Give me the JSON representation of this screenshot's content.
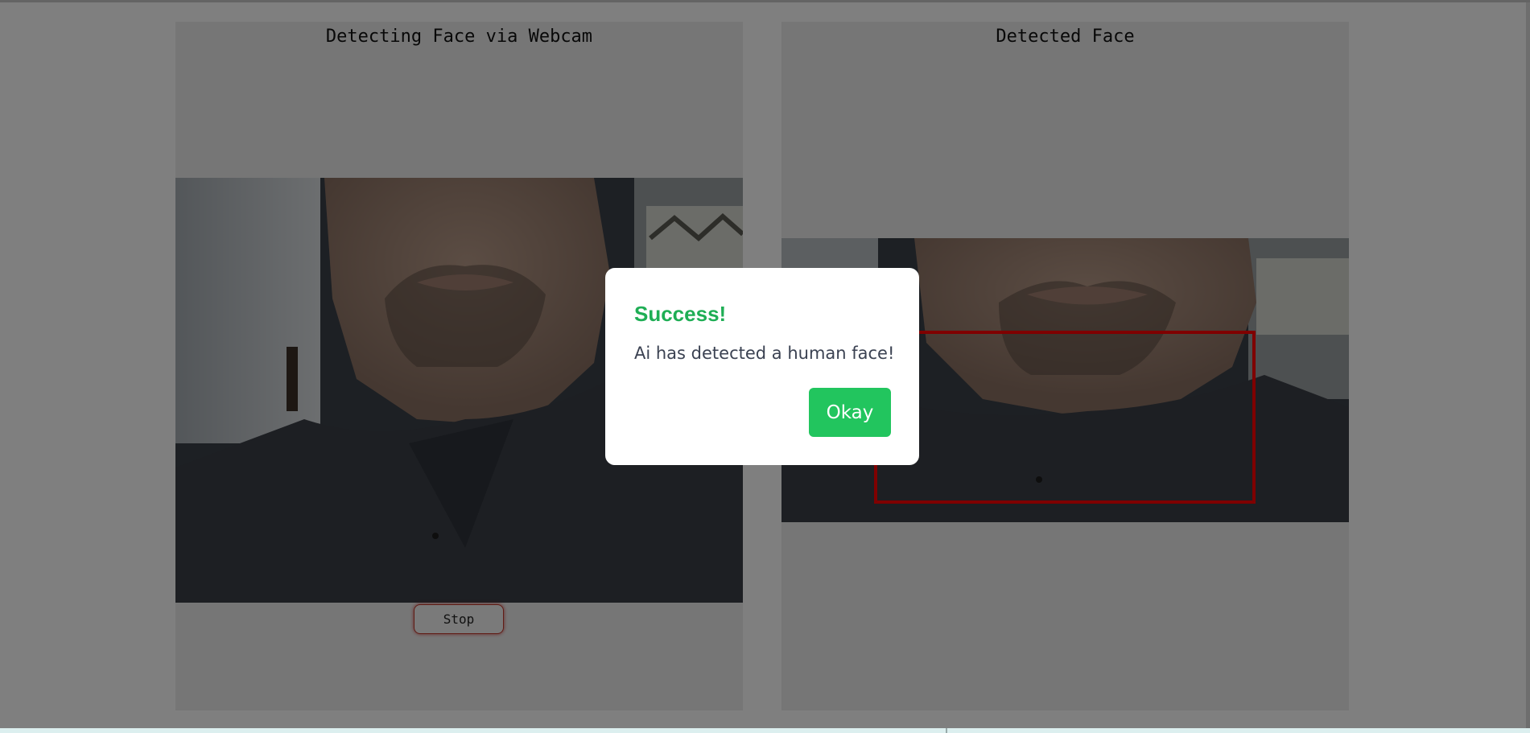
{
  "left_panel": {
    "title": "Detecting Face via Webcam",
    "stop_label": "Stop"
  },
  "right_panel": {
    "title": "Detected Face"
  },
  "dialog": {
    "title": "Success!",
    "message": "Ai has detected a human face!",
    "confirm_label": "Okay"
  },
  "colors": {
    "success_title": "#1fae55",
    "confirm_button": "#22c55e",
    "detection_box": "#ff0000",
    "stop_glow": "#c0392b"
  }
}
